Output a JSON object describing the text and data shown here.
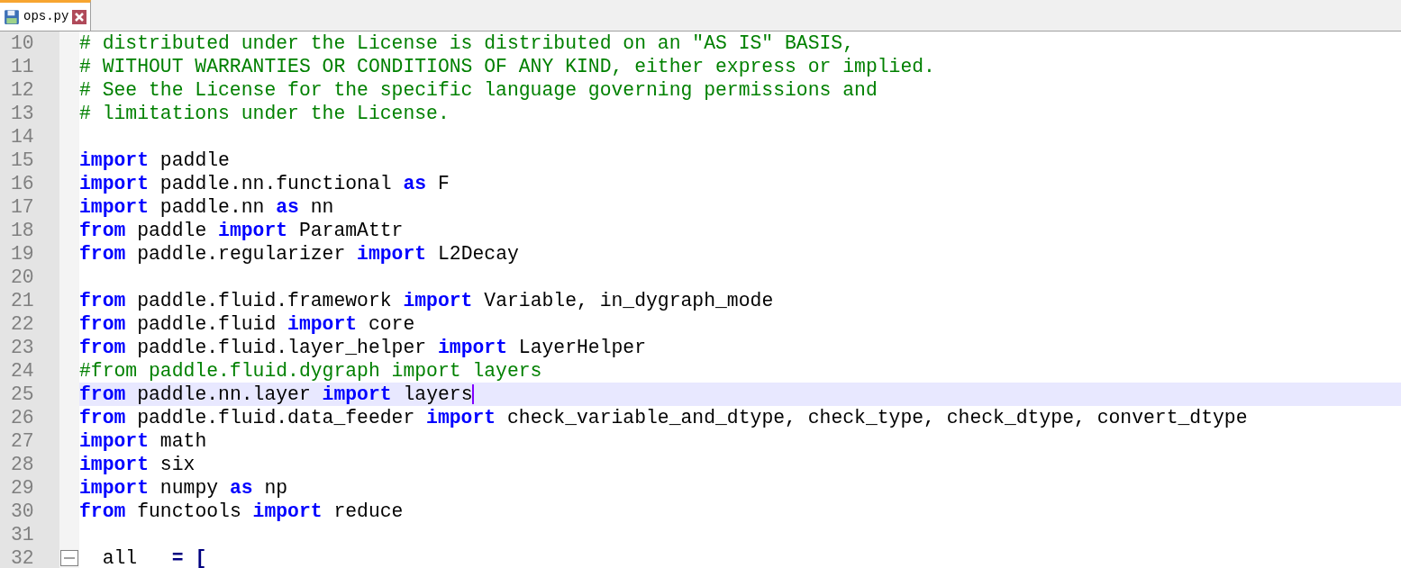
{
  "tabs": [
    {
      "label": "ops.py",
      "selected": true
    }
  ],
  "lines": [
    {
      "number": "10",
      "highlighted": false,
      "tokens": [
        {
          "kind": "comment",
          "text": "# distributed under the License is distributed on an \"AS IS\" BASIS,"
        }
      ]
    },
    {
      "number": "11",
      "highlighted": false,
      "tokens": [
        {
          "kind": "comment",
          "text": "# WITHOUT WARRANTIES OR CONDITIONS OF ANY KIND, either express or implied."
        }
      ]
    },
    {
      "number": "12",
      "highlighted": false,
      "tokens": [
        {
          "kind": "comment",
          "text": "# See the License for the specific language governing permissions and"
        }
      ]
    },
    {
      "number": "13",
      "highlighted": false,
      "tokens": [
        {
          "kind": "comment",
          "text": "# limitations under the License."
        }
      ]
    },
    {
      "number": "14",
      "highlighted": false
    },
    {
      "number": "15",
      "highlighted": false,
      "tokens": [
        {
          "kind": "keyword",
          "text": "import"
        },
        {
          "kind": "plain",
          "text": " paddle"
        }
      ]
    },
    {
      "number": "16",
      "highlighted": false,
      "tokens": [
        {
          "kind": "keyword",
          "text": "import"
        },
        {
          "kind": "plain",
          "text": " paddle.nn.functional "
        },
        {
          "kind": "keyword",
          "text": "as"
        },
        {
          "kind": "plain",
          "text": " F"
        }
      ]
    },
    {
      "number": "17",
      "highlighted": false,
      "tokens": [
        {
          "kind": "keyword",
          "text": "import"
        },
        {
          "kind": "plain",
          "text": " paddle.nn "
        },
        {
          "kind": "keyword",
          "text": "as"
        },
        {
          "kind": "plain",
          "text": " nn"
        }
      ]
    },
    {
      "number": "18",
      "highlighted": false,
      "tokens": [
        {
          "kind": "keyword",
          "text": "from"
        },
        {
          "kind": "plain",
          "text": " paddle "
        },
        {
          "kind": "keyword",
          "text": "import"
        },
        {
          "kind": "plain",
          "text": " ParamAttr"
        }
      ]
    },
    {
      "number": "19",
      "highlighted": false,
      "tokens": [
        {
          "kind": "keyword",
          "text": "from"
        },
        {
          "kind": "plain",
          "text": " paddle.regularizer "
        },
        {
          "kind": "keyword",
          "text": "import"
        },
        {
          "kind": "plain",
          "text": " L2Decay"
        }
      ]
    },
    {
      "number": "20",
      "highlighted": false
    },
    {
      "number": "21",
      "highlighted": false,
      "tokens": [
        {
          "kind": "keyword",
          "text": "from"
        },
        {
          "kind": "plain",
          "text": " paddle.fluid.framework "
        },
        {
          "kind": "keyword",
          "text": "import"
        },
        {
          "kind": "plain",
          "text": " Variable, in_dygraph_mode"
        }
      ]
    },
    {
      "number": "22",
      "highlighted": false,
      "tokens": [
        {
          "kind": "keyword",
          "text": "from"
        },
        {
          "kind": "plain",
          "text": " paddle.fluid "
        },
        {
          "kind": "keyword",
          "text": "import"
        },
        {
          "kind": "plain",
          "text": " core"
        }
      ]
    },
    {
      "number": "23",
      "highlighted": false,
      "tokens": [
        {
          "kind": "keyword",
          "text": "from"
        },
        {
          "kind": "plain",
          "text": " paddle.fluid.layer_helper "
        },
        {
          "kind": "keyword",
          "text": "import"
        },
        {
          "kind": "plain",
          "text": " LayerHelper"
        }
      ]
    },
    {
      "number": "24",
      "highlighted": false,
      "tokens": [
        {
          "kind": "comment",
          "text": "#from paddle.fluid.dygraph import layers"
        }
      ]
    },
    {
      "number": "25",
      "highlighted": true,
      "tokens": [
        {
          "kind": "keyword",
          "text": "from"
        },
        {
          "kind": "plain",
          "text": " paddle.nn.layer "
        },
        {
          "kind": "keyword",
          "text": "import"
        },
        {
          "kind": "plain",
          "text": " layers"
        }
      ]
    },
    {
      "number": "26",
      "highlighted": false,
      "tokens": [
        {
          "kind": "keyword",
          "text": "from"
        },
        {
          "kind": "plain",
          "text": " paddle.fluid.data_feeder "
        },
        {
          "kind": "keyword",
          "text": "import"
        },
        {
          "kind": "plain",
          "text": " check_variable_and_dtype, check_type, check_dtype, convert_dtype"
        }
      ]
    },
    {
      "number": "27",
      "highlighted": false,
      "tokens": [
        {
          "kind": "keyword",
          "text": "import"
        },
        {
          "kind": "plain",
          "text": " math"
        }
      ]
    },
    {
      "number": "28",
      "highlighted": false,
      "tokens": [
        {
          "kind": "keyword",
          "text": "import"
        },
        {
          "kind": "plain",
          "text": " six"
        }
      ]
    },
    {
      "number": "29",
      "highlighted": false,
      "tokens": [
        {
          "kind": "keyword",
          "text": "import"
        },
        {
          "kind": "plain",
          "text": " numpy "
        },
        {
          "kind": "keyword",
          "text": "as"
        },
        {
          "kind": "plain",
          "text": " np"
        }
      ]
    },
    {
      "number": "30",
      "highlighted": false,
      "tokens": [
        {
          "kind": "keyword",
          "text": "from"
        },
        {
          "kind": "plain",
          "text": " functools "
        },
        {
          "kind": "keyword",
          "text": "import"
        },
        {
          "kind": "plain",
          "text": " reduce"
        }
      ]
    },
    {
      "number": "31",
      "highlighted": false
    },
    {
      "number": "32",
      "highlighted": false,
      "fold": true,
      "tokens": [
        {
          "kind": "plain",
          "text": "  all   "
        },
        {
          "kind": "operator",
          "text": "="
        },
        {
          "kind": "bracket",
          "text": " ["
        }
      ]
    }
  ]
}
